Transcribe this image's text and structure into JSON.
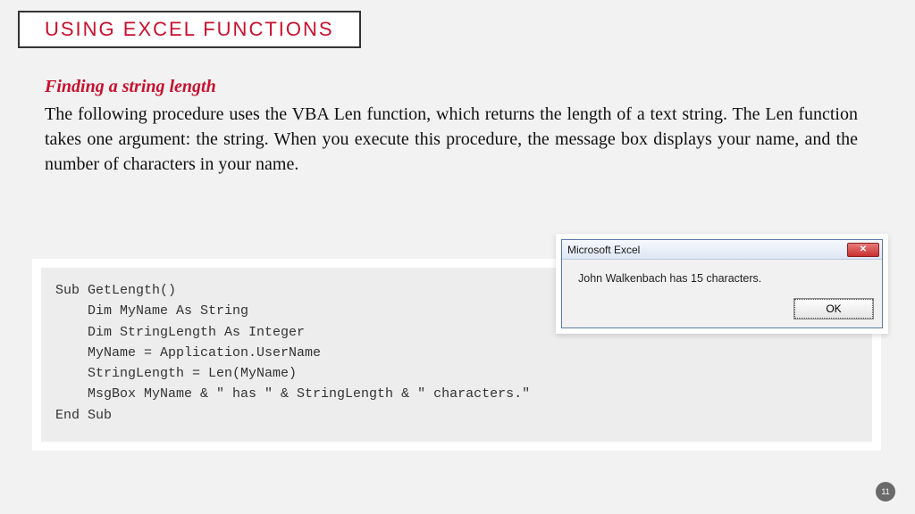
{
  "header": {
    "title": "USING EXCEL FUNCTIONS"
  },
  "section": {
    "subtitle": "Finding a string length",
    "body": "The following procedure uses the VBA Len function, which returns the length of a text string. The Len function takes one argument: the string. When you execute this procedure, the message box displays your name, and the number of characters in your name."
  },
  "code": "Sub GetLength()\n    Dim MyName As String\n    Dim StringLength As Integer\n    MyName = Application.UserName\n    StringLength = Len(MyName)\n    MsgBox MyName & \" has \" & StringLength & \" characters.\"\nEnd Sub",
  "dialog": {
    "title": "Microsoft Excel",
    "message": "John Walkenbach has 15 characters.",
    "ok_label": "OK",
    "close_glyph": "✕"
  },
  "page_number": "11"
}
